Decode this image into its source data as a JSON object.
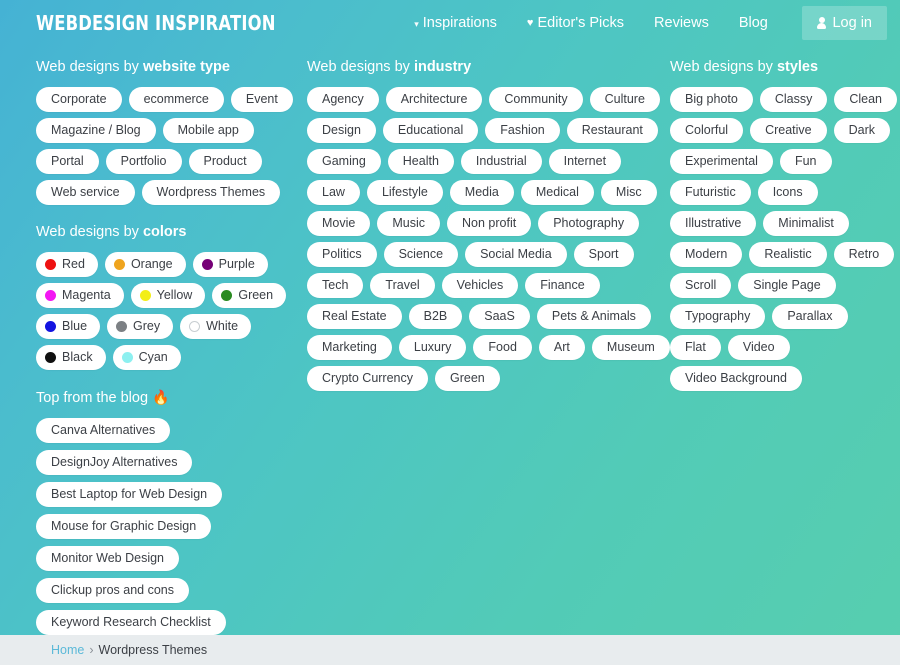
{
  "header": {
    "logo": "Webdesign Inspiration",
    "nav": [
      {
        "label": "Inspirations",
        "icon": "chevron-down-icon"
      },
      {
        "label": "Editor's Picks",
        "icon": "heart-icon"
      },
      {
        "label": "Reviews",
        "icon": ""
      },
      {
        "label": "Blog",
        "icon": ""
      }
    ],
    "login_label": "Log in"
  },
  "sections": {
    "website_type": {
      "title_prefix": "Web designs by ",
      "title_strong": "website type",
      "items": [
        "Corporate",
        "ecommerce",
        "Event",
        "Magazine / Blog",
        "Mobile app",
        "Portal",
        "Portfolio",
        "Product",
        "Web service",
        "Wordpress Themes"
      ]
    },
    "colors": {
      "title_prefix": "Web designs by ",
      "title_strong": "colors",
      "items": [
        {
          "label": "Red",
          "color": "#ee1111"
        },
        {
          "label": "Orange",
          "color": "#efa41e"
        },
        {
          "label": "Purple",
          "color": "#760076"
        },
        {
          "label": "Magenta",
          "color": "#f316f3"
        },
        {
          "label": "Yellow",
          "color": "#f3ee16"
        },
        {
          "label": "Green",
          "color": "#2a8a21"
        },
        {
          "label": "Blue",
          "color": "#1414e0"
        },
        {
          "label": "Grey",
          "color": "#7c8084"
        },
        {
          "label": "White",
          "color": "#ffffff"
        },
        {
          "label": "Black",
          "color": "#101010"
        },
        {
          "label": "Cyan",
          "color": "#8df0f0"
        }
      ]
    },
    "blog": {
      "title": "Top from the blog ",
      "emoji": "🔥",
      "items": [
        "Canva Alternatives",
        "DesignJoy Alternatives",
        "Best Laptop for Web Design",
        "Mouse for Graphic Design",
        "Monitor Web Design",
        "Clickup pros and cons",
        "Keyword Research Checklist"
      ]
    },
    "industry": {
      "title_prefix": "Web designs by ",
      "title_strong": "industry",
      "items": [
        "Agency",
        "Architecture",
        "Community",
        "Culture",
        "Design",
        "Educational",
        "Fashion",
        "Restaurant",
        "Gaming",
        "Health",
        "Industrial",
        "Internet",
        "Law",
        "Lifestyle",
        "Media",
        "Medical",
        "Misc",
        "Movie",
        "Music",
        "Non profit",
        "Photography",
        "Politics",
        "Science",
        "Social Media",
        "Sport",
        "Tech",
        "Travel",
        "Vehicles",
        "Finance",
        "Real Estate",
        "B2B",
        "SaaS",
        "Pets & Animals",
        "Marketing",
        "Luxury",
        "Food",
        "Art",
        "Museum",
        "Crypto Currency",
        "Green"
      ]
    },
    "styles": {
      "title_prefix": "Web designs by ",
      "title_strong": "styles",
      "items": [
        "Big photo",
        "Classy",
        "Clean",
        "Colorful",
        "Creative",
        "Dark",
        "Experimental",
        "Fun",
        "Futuristic",
        "Icons",
        "Illustrative",
        "Minimalist",
        "Modern",
        "Realistic",
        "Retro",
        "Scroll",
        "Single Page",
        "Typography",
        "Parallax",
        "Flat",
        "Video",
        "Video Background"
      ]
    }
  },
  "breadcrumb": {
    "home": "Home",
    "separator": "›",
    "current": "Wordpress Themes"
  }
}
